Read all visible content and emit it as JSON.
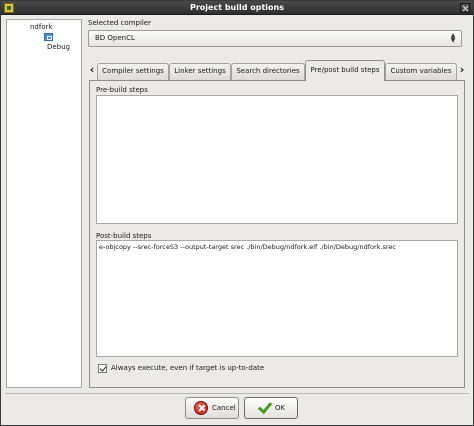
{
  "window": {
    "title": "Project build options"
  },
  "tree": {
    "root_label": "ndfork",
    "children": [
      {
        "label": "Debug",
        "icon": "target-config-icon"
      }
    ]
  },
  "compiler": {
    "group_label": "Selected compiler",
    "selected_value": "BD OpenCL"
  },
  "tabs": [
    {
      "label": "Compiler settings",
      "active": false
    },
    {
      "label": "Linker settings",
      "active": false
    },
    {
      "label": "Search directories",
      "active": false
    },
    {
      "label": "Pre/post build steps",
      "active": true
    },
    {
      "label": "Custom variables",
      "active": false
    }
  ],
  "prebuild": {
    "group_label": "Pre-build steps",
    "text": ""
  },
  "postbuild": {
    "group_label": "Post-build steps",
    "text": "e-objcopy --srec-forceS3 --output-target srec ./bin/Debug/ndfork.elf ./bin/Debug/ndfork.srec"
  },
  "always_execute": {
    "label": "Always execute, even if target is up-to-date",
    "checked": true
  },
  "buttons": {
    "cancel_label": "Cancel",
    "ok_label": "OK"
  }
}
